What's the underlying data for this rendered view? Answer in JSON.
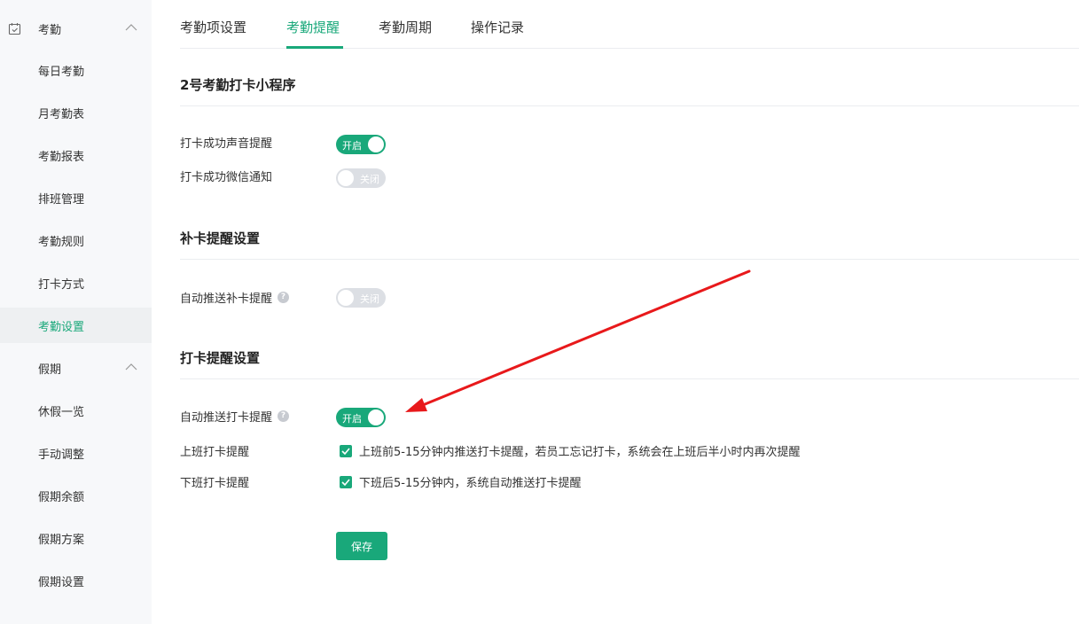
{
  "sidebar": {
    "group_attendance": {
      "label": "考勤",
      "icon": "calendar-check-icon"
    },
    "attendance_items": [
      {
        "label": "每日考勤"
      },
      {
        "label": "月考勤表"
      },
      {
        "label": "考勤报表"
      },
      {
        "label": "排班管理"
      },
      {
        "label": "考勤规则"
      },
      {
        "label": "打卡方式"
      },
      {
        "label": "考勤设置",
        "active": true
      }
    ],
    "group_holiday": {
      "label": "假期"
    },
    "holiday_items": [
      {
        "label": "休假一览"
      },
      {
        "label": "手动调整"
      },
      {
        "label": "假期余额"
      },
      {
        "label": "假期方案"
      },
      {
        "label": "假期设置"
      }
    ]
  },
  "tabs": [
    {
      "label": "考勤项设置"
    },
    {
      "label": "考勤提醒",
      "active": true
    },
    {
      "label": "考勤周期"
    },
    {
      "label": "操作记录"
    }
  ],
  "sections": {
    "miniprogram": {
      "title": "2号考勤打卡小程序",
      "rows": [
        {
          "label": "打卡成功声音提醒",
          "state": "开启"
        },
        {
          "label": "打卡成功微信通知",
          "state": "关闭"
        }
      ]
    },
    "makeup": {
      "title": "补卡提醒设置",
      "rows": [
        {
          "label": "自动推送补卡提醒",
          "help": "?",
          "state": "关闭"
        }
      ]
    },
    "clockin": {
      "title": "打卡提醒设置",
      "auto": {
        "label": "自动推送打卡提醒",
        "help": "?",
        "state": "开启"
      },
      "on_duty": {
        "label": "上班打卡提醒",
        "text": "上班前5-15分钟内推送打卡提醒，若员工忘记打卡，系统会在上班后半小时内再次提醒"
      },
      "off_duty": {
        "label": "下班打卡提醒",
        "text": "下班后5-15分钟内，系统自动推送打卡提醒"
      }
    }
  },
  "save_label": "保存",
  "colors": {
    "accent": "#19a87a",
    "annotation_arrow": "#e8191b"
  }
}
